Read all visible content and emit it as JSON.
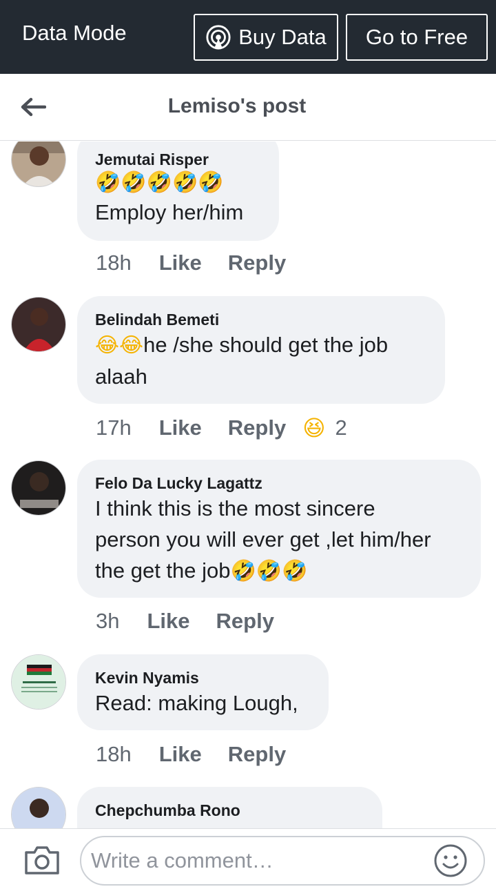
{
  "data_bar": {
    "mode_label": "Data Mode",
    "buy_label": "Buy Data",
    "free_label": "Go to Free"
  },
  "header": {
    "title": "Lemiso's post"
  },
  "comments": [
    {
      "author": "Jemutai Risper",
      "emoji": "🤣🤣🤣🤣🤣",
      "text": "Employ her/him",
      "time": "18h",
      "like": "Like",
      "reply": "Reply"
    },
    {
      "author": "Belindah Bemeti",
      "emoji": "😂😂",
      "text": "he /she should get the job alaah",
      "time": "17h",
      "like": "Like",
      "reply": "Reply",
      "reaction_icon": "laughing-squint-emoji",
      "reaction_count": "2"
    },
    {
      "author": "Felo Da Lucky Lagattz",
      "text_line1": "I think this is the most sincere",
      "text_line2": "person you will ever get ,let him/her",
      "text_line3": "the get  the job",
      "emoji": "🤣🤣🤣",
      "time": "3h",
      "like": "Like",
      "reply": "Reply"
    },
    {
      "author": "Kevin Nyamis",
      "text": "Read: making Lough,",
      "time": "18h",
      "like": "Like",
      "reply": "Reply"
    },
    {
      "author": "Chepchumba Rono"
    }
  ],
  "composer": {
    "placeholder": "Write a comment…"
  },
  "colors": {
    "data_bar_bg": "#232a32",
    "bubble_bg": "#f0f2f5",
    "meta_text": "#606770",
    "title_text": "#4b4f56"
  }
}
